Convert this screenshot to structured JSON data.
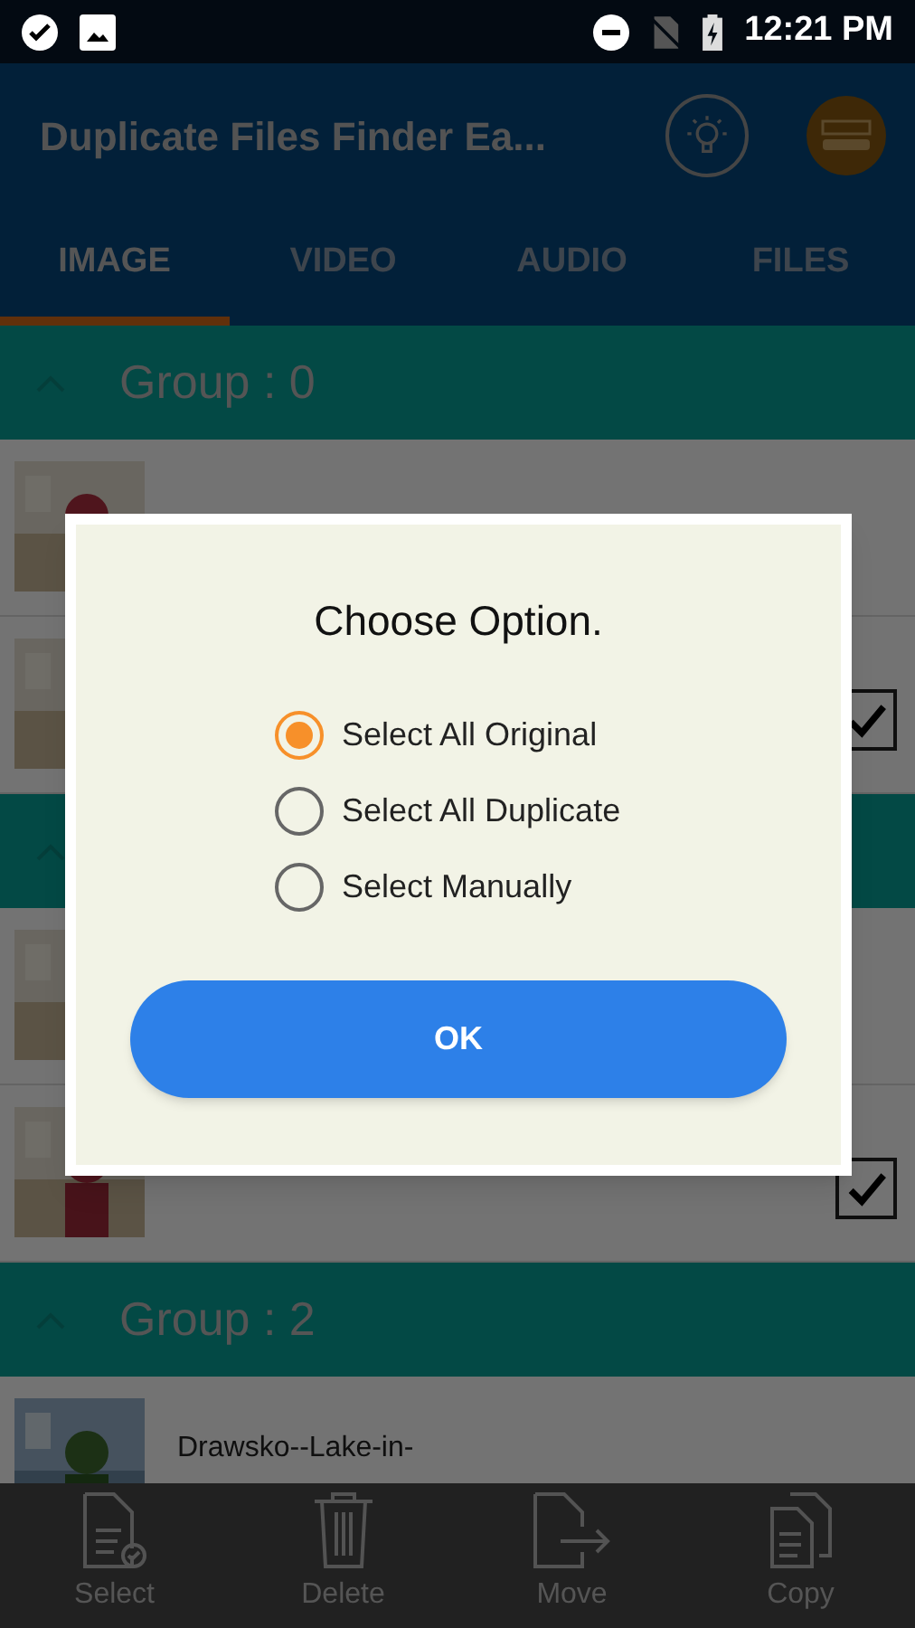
{
  "status_bar": {
    "time": "12:21 PM"
  },
  "app_bar": {
    "title": "Duplicate Files Finder Ea..."
  },
  "tabs": [
    {
      "label": "IMAGE",
      "selected": true
    },
    {
      "label": "VIDEO",
      "selected": false
    },
    {
      "label": "AUDIO",
      "selected": false
    },
    {
      "label": "FILES",
      "selected": false
    }
  ],
  "groups": [
    {
      "title": "Group : 0",
      "rows": [
        {},
        {
          "checked": true
        }
      ]
    },
    {
      "rows": [
        {},
        {
          "checked": true
        }
      ]
    },
    {
      "title": "Group : 2",
      "rows": [
        {
          "name": "Drawsko--Lake-in-"
        }
      ]
    }
  ],
  "bottom_bar": [
    {
      "label": "Select",
      "kind": "select"
    },
    {
      "label": "Delete",
      "kind": "delete"
    },
    {
      "label": "Move",
      "kind": "move"
    },
    {
      "label": "Copy",
      "kind": "copy"
    }
  ],
  "dialog": {
    "title": "Choose Option.",
    "options": [
      {
        "label": "Select All Original",
        "selected": true
      },
      {
        "label": "Select All Duplicate",
        "selected": false
      },
      {
        "label": "Select Manually",
        "selected": false
      }
    ],
    "button": "OK"
  }
}
